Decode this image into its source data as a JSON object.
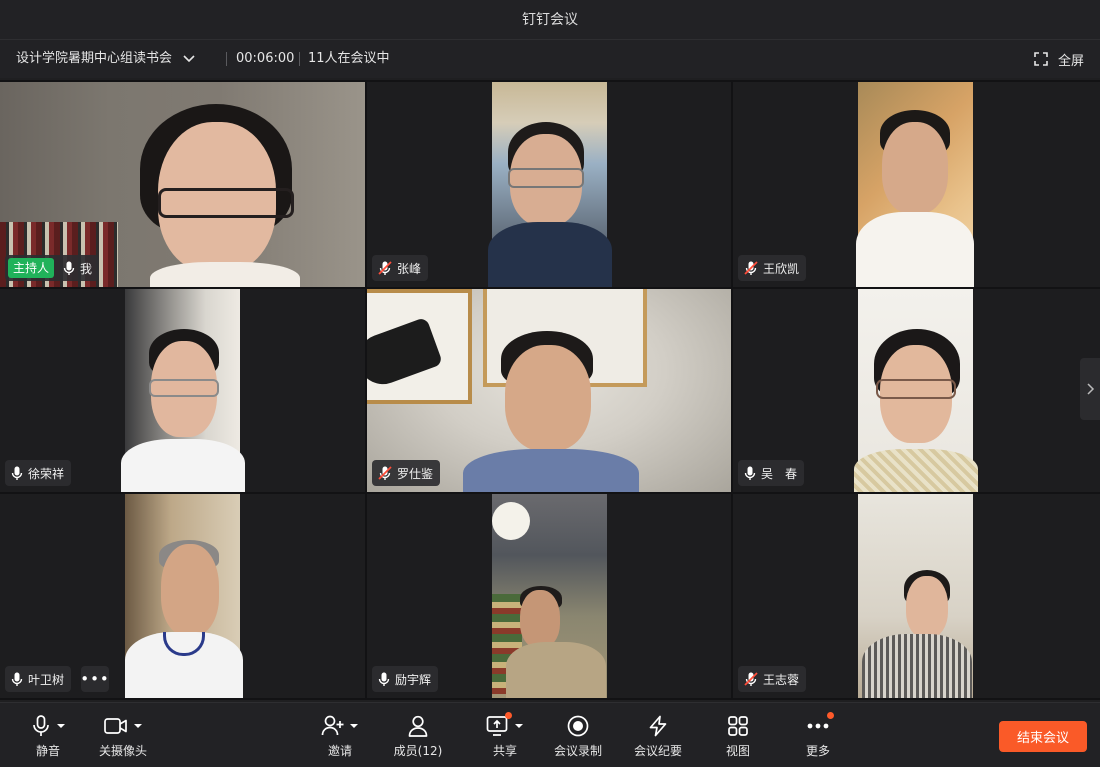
{
  "window": {
    "title": "钉钉会议"
  },
  "meeting": {
    "topic": "设计学院暑期中心组读书会",
    "elapsed": "00:06:00",
    "participants_status": "11人在会议中",
    "fullscreen_label": "全屏"
  },
  "tiles": [
    {
      "name": "我",
      "host_badge": "主持人",
      "muted": false
    },
    {
      "name": "张峰",
      "muted": true
    },
    {
      "name": "王欣凯",
      "muted": true
    },
    {
      "name": "徐荣祥",
      "muted": false
    },
    {
      "name": "罗仕鉴",
      "muted": true
    },
    {
      "name": "吴　春",
      "muted": false
    },
    {
      "name": "叶卫树",
      "muted": false
    },
    {
      "name": "励宇辉",
      "muted": false
    },
    {
      "name": "王志蓉",
      "muted": true
    }
  ],
  "more_options_glyph": "•••",
  "toolbar": {
    "mute": "静音",
    "camera": "关摄像头",
    "invite": "邀请",
    "members": "成员(12)",
    "share": "共享",
    "record": "会议录制",
    "minutes": "会议纪要",
    "view": "视图",
    "more": "更多",
    "end": "结束会议"
  },
  "colors": {
    "accent_end": "#fa5a28",
    "host_badge": "#20b25a",
    "notify_dot": "#ff5a2a"
  }
}
